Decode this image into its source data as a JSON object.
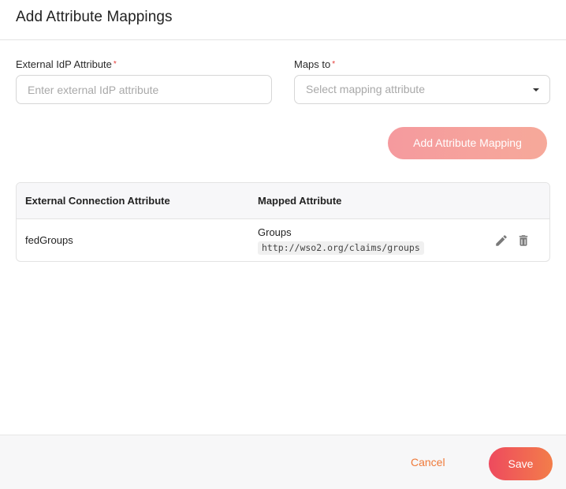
{
  "header": {
    "title": "Add Attribute Mappings"
  },
  "form": {
    "external_label": "External IdP Attribute",
    "external_required": "*",
    "external_placeholder": "Enter external IdP attribute",
    "maps_to_label": "Maps to",
    "maps_to_required": "*",
    "maps_to_placeholder": "Select mapping attribute",
    "add_button_label": "Add Attribute Mapping"
  },
  "table": {
    "columns": [
      "External Connection Attribute",
      "Mapped Attribute"
    ],
    "rows": [
      {
        "external_attribute": "fedGroups",
        "mapped_name": "Groups",
        "mapped_uri": "http://wso2.org/claims/groups"
      }
    ]
  },
  "footer": {
    "cancel_label": "Cancel",
    "save_label": "Save"
  },
  "colors": {
    "accent_start": "#ee4a5e",
    "accent_end": "#f37d4a",
    "cancel_text": "#ef7a3a",
    "required_star": "#e53935"
  },
  "icons": [
    "chevron-down-icon",
    "pencil-icon",
    "trash-icon"
  ]
}
